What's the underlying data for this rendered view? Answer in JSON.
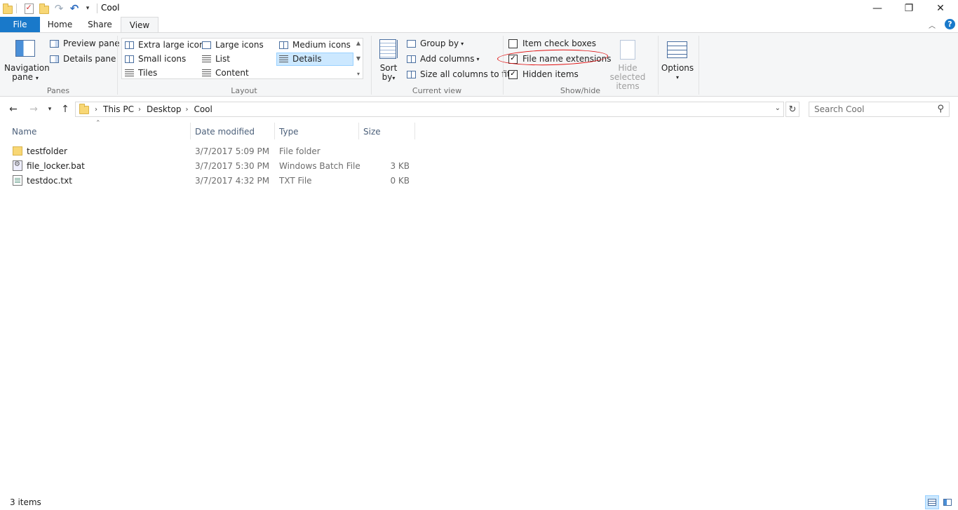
{
  "window": {
    "title": "Cool",
    "minimize_icon": "minimize-icon",
    "maximize_icon": "restore-icon",
    "close_icon": "close-icon"
  },
  "quick_access": {
    "icons": [
      "folder-icon",
      "properties-icon",
      "new-folder-icon",
      "undo-icon",
      "redo-icon",
      "customize-dropdown-icon"
    ]
  },
  "tabs": {
    "file": "File",
    "home": "Home",
    "share": "Share",
    "view": "View"
  },
  "ribbon": {
    "panes": {
      "navigation_pane": "Navigation",
      "navigation_pane_line2": "pane",
      "preview_pane": "Preview pane",
      "details_pane": "Details pane",
      "group_label": "Panes"
    },
    "layout": {
      "extra_large_icons": "Extra large icons",
      "large_icons": "Large icons",
      "medium_icons": "Medium icons",
      "small_icons": "Small icons",
      "list": "List",
      "details": "Details",
      "tiles": "Tiles",
      "content": "Content",
      "selected": "Details",
      "group_label": "Layout"
    },
    "current_view": {
      "sort_by": "Sort",
      "sort_by_line2": "by",
      "group_by": "Group by",
      "add_columns": "Add columns",
      "size_columns": "Size all columns to fit",
      "group_label": "Current view"
    },
    "show_hide": {
      "item_check_boxes": "Item check boxes",
      "item_check_boxes_checked": false,
      "file_name_extensions": "File name extensions",
      "file_name_extensions_checked": true,
      "hidden_items": "Hidden items",
      "hidden_items_checked": true,
      "hide_selected_items": "Hide selected",
      "hide_selected_items_line2": "items",
      "group_label": "Show/hide"
    },
    "options": {
      "label": "Options"
    },
    "annotation_color": "#e01010"
  },
  "address": {
    "breadcrumbs": [
      "This PC",
      "Desktop",
      "Cool"
    ],
    "search_placeholder": "Search Cool"
  },
  "file_list": {
    "columns": {
      "name": "Name",
      "date_modified": "Date modified",
      "type": "Type",
      "size": "Size"
    },
    "rows": [
      {
        "name": "testfolder",
        "date": "3/7/2017 5:09 PM",
        "type": "File folder",
        "size": "",
        "icon": "folder-icon"
      },
      {
        "name": "file_locker.bat",
        "date": "3/7/2017 5:30 PM",
        "type": "Windows Batch File",
        "size": "3 KB",
        "icon": "batch-file-icon"
      },
      {
        "name": "testdoc.txt",
        "date": "3/7/2017 4:32 PM",
        "type": "TXT File",
        "size": "0 KB",
        "icon": "text-file-icon"
      }
    ]
  },
  "status": {
    "item_count": "3 items"
  },
  "colors": {
    "accent": "#1979ca",
    "selection": "#cce8ff",
    "ribbon_bg": "#f5f6f7"
  }
}
